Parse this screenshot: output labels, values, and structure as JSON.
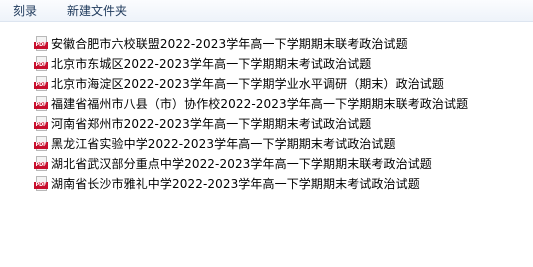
{
  "toolbar": {
    "burn_label": "刻录",
    "new_folder_label": "新建文件夹"
  },
  "files": [
    {
      "icon": "pdf-file-icon",
      "badge": "PDF",
      "name": "安徽合肥市六校联盟2022-2023学年高一下学期期末联考政治试题"
    },
    {
      "icon": "pdf-file-icon",
      "badge": "PDF",
      "name": "北京市东城区2022-2023学年高一下学期期末考试政治试题"
    },
    {
      "icon": "pdf-file-icon",
      "badge": "PDF",
      "name": "北京市海淀区2022-2023学年高一下学期学业水平调研（期末）政治试题"
    },
    {
      "icon": "pdf-file-icon",
      "badge": "PDF",
      "name": "福建省福州市八县（市）协作校2022-2023学年高一下学期期末联考政治试题"
    },
    {
      "icon": "pdf-file-icon",
      "badge": "PDF",
      "name": "河南省郑州市2022-2023学年高一下学期期末考试政治试题"
    },
    {
      "icon": "pdf-file-icon",
      "badge": "PDF",
      "name": "黑龙江省实验中学2022-2023学年高一下学期期末考试政治试题"
    },
    {
      "icon": "pdf-file-icon",
      "badge": "PDF",
      "name": "湖北省武汉部分重点中学2022-2023学年高一下学期期末联考政治试题"
    },
    {
      "icon": "pdf-file-icon",
      "badge": "PDF",
      "name": "湖南省长沙市雅礼中学2022-2023学年高一下学期期末考试政治试题"
    }
  ]
}
